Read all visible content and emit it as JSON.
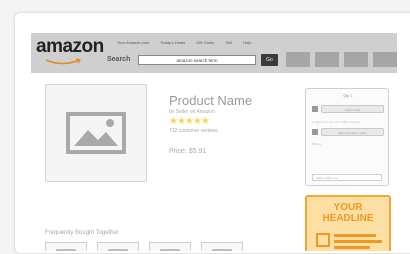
{
  "header": {
    "logo": "amazon",
    "top_links": [
      "Your Amazon.com",
      "Today's Deals",
      "Gift Cards",
      "Sell",
      "Help"
    ],
    "search_label": "Search",
    "search_value": "amazon search term",
    "go_label": "Go"
  },
  "product": {
    "name": "Product Name",
    "seller": "by Seller on Amazon",
    "stars": "★★★★★",
    "reviews": "732 customer reviews",
    "price": "Price: $5.91"
  },
  "buybox": {
    "quantity": "Qty: 1",
    "add_to_cart": "Add to Cart",
    "or_text": "or Sign in to turn on 1-Click ordering",
    "one_click": "Buy now with 1-Click",
    "ship_text": "Ship to:",
    "wishlist": "Add to Wish List"
  },
  "ad": {
    "headline_line1": "YOUR",
    "headline_line2": "HEADLINE"
  },
  "frequently_bought": "Frequently Bought Together",
  "colors": {
    "header_bg": "#cfcfcf",
    "ad_bg": "#fcdfa2",
    "ad_accent": "#ee9a22",
    "stars": "#f4d35a"
  }
}
